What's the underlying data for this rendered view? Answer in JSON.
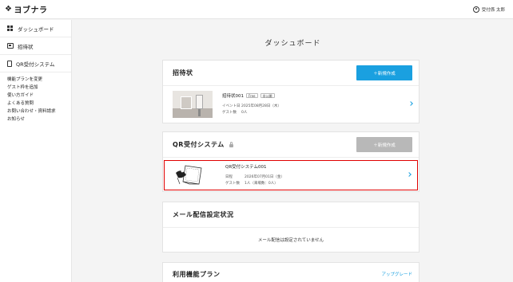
{
  "header": {
    "logo_text": "ヨブナラ",
    "logo_mark": "❖",
    "user_name": "受付係 太郎"
  },
  "sidebar": {
    "items": [
      {
        "label": "ダッシュボード"
      },
      {
        "label": "招待状"
      },
      {
        "label": "QR受付システム"
      }
    ],
    "links": [
      "機能プランを変更",
      "ゲスト枠を追加",
      "使い方ガイド",
      "よくある質問",
      "お問い合わせ・資料請求",
      "お知らせ"
    ]
  },
  "main": {
    "title": "ダッシュボード",
    "invitations": {
      "title": "招待状",
      "new_button": "＋新規作成",
      "item": {
        "name": "招待状001",
        "badge_plan": "Free",
        "badge_status": "非公開",
        "event_date_label": "イベント日",
        "event_date_value": "2025年08月28日（木）",
        "guest_count_label": "ゲスト数",
        "guest_count_value": "0人"
      }
    },
    "qr": {
      "title": "QR受付システム",
      "new_button": "＋新規作成",
      "item": {
        "name": "QR受付システム001",
        "date_label": "日程",
        "date_value": "2026年07月01日（金）",
        "guest_count_label": "ゲスト数",
        "guest_count_value": "1人（来場数：0人）"
      }
    },
    "mail": {
      "title": "メール配信設定状況",
      "empty_message": "メール配信は設定されていません"
    },
    "plan": {
      "title": "利用機能プラン",
      "upgrade_link": "アップグレード"
    }
  },
  "colors": {
    "accent": "#1aa0e0",
    "highlight_border": "#e00000",
    "disabled_button": "#b8b8b8"
  }
}
